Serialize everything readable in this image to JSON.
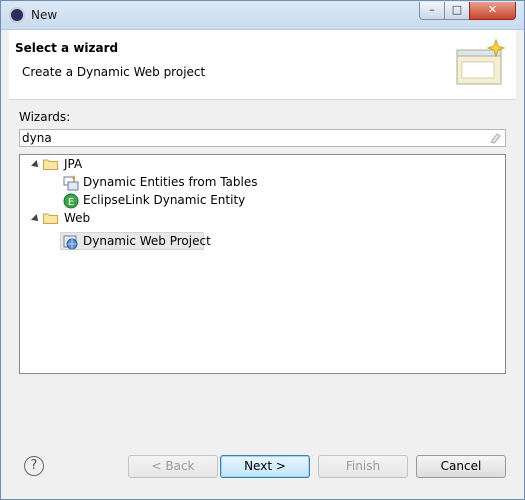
{
  "window": {
    "title": "New",
    "minimize_label": "–",
    "maximize_label": "□",
    "close_label": "✕"
  },
  "header": {
    "title": "Select a wizard",
    "description": "Create a Dynamic Web project"
  },
  "wizards": {
    "label": "Wizards:",
    "filter_value": "dyna",
    "tree": [
      {
        "label": "JPA",
        "children": [
          "Dynamic Entities from Tables",
          "EclipseLink Dynamic Entity"
        ]
      },
      {
        "label": "Web",
        "children": [
          "Dynamic Web Project"
        ]
      }
    ]
  },
  "buttons": {
    "help": "?",
    "back": "< Back",
    "next": "Next >",
    "finish": "Finish",
    "cancel": "Cancel"
  },
  "colors": {
    "title_bar": "#c9dbef",
    "close_button": "#c8442f",
    "default_button": "#bee6fd",
    "selection": "#e8e8e8"
  }
}
